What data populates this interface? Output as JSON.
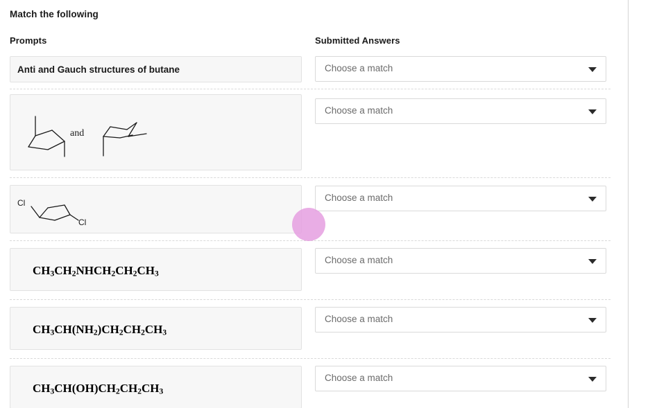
{
  "header": {
    "title": "Match the following"
  },
  "columns": {
    "prompts_label": "Prompts",
    "answers_label": "Submitted Answers"
  },
  "dropdown": {
    "placeholder": "Choose a match",
    "caret_icon": "chevron-down-icon"
  },
  "rows": [
    {
      "kind": "text",
      "prompt": "Anti and Gauch structures of butane",
      "answer": "Choose a match"
    },
    {
      "kind": "structure",
      "structure_name": "butane-anti-and-gauche-conformers",
      "conjunction": "and",
      "answer": "Choose a match"
    },
    {
      "kind": "structure",
      "structure_name": "dichlorocyclohexane-chair-structure",
      "label_left": "Cl",
      "label_right": "Cl",
      "answer": "Choose a match"
    },
    {
      "kind": "formula",
      "formula_html": "CH<sub>3</sub>CH<sub>2</sub>NHCH<sub>2</sub>CH<sub>2</sub>CH<sub>3</sub>",
      "formula_text": "CH3CH2NHCH2CH2CH3",
      "answer": "Choose a match"
    },
    {
      "kind": "formula",
      "formula_html": "CH<sub>3</sub>CH(NH<sub>2</sub>)CH<sub>2</sub>CH<sub>2</sub>CH<sub>3</sub>",
      "formula_text": "CH3CH(NH2)CH2CH2CH3",
      "answer": "Choose a match"
    },
    {
      "kind": "formula",
      "formula_html": "CH<sub>3</sub>CH(OH)CH<sub>2</sub>CH<sub>2</sub>CH<sub>3</sub>",
      "formula_text": "CH3CH(OH)CH2CH2CH3",
      "answer": "Choose a match"
    }
  ],
  "cursor": {
    "name": "cursor-highlight",
    "color": "#e59fe0"
  }
}
